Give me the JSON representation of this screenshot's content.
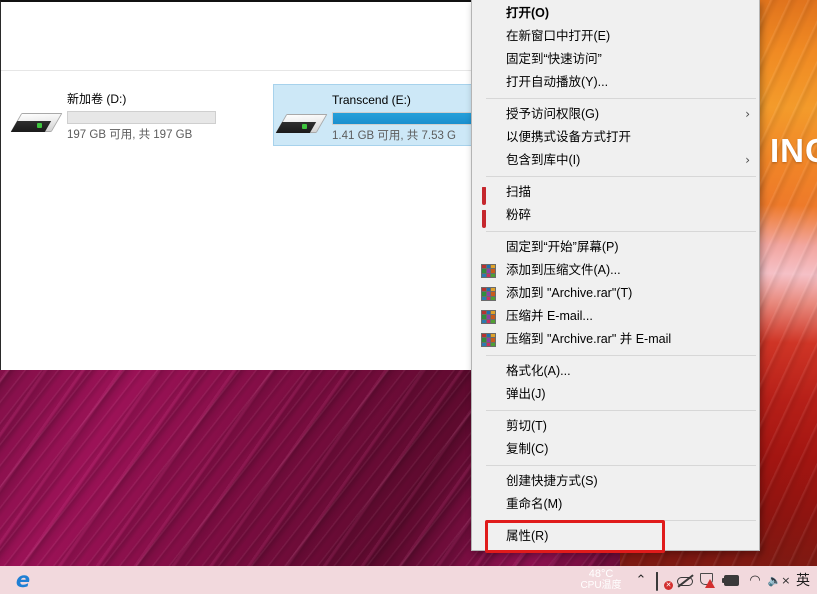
{
  "explorer": {
    "drives": [
      {
        "name": "新加卷 (D:)",
        "capacity_text": "197 GB 可用, 共 197 GB",
        "used_percent": 0,
        "selected": false,
        "icon": "removable-drive-icon"
      },
      {
        "name": "Transcend (E:)",
        "capacity_text": "1.41 GB 可用, 共 7.53 G",
        "used_percent": 100,
        "selected": true,
        "icon": "removable-drive-icon"
      }
    ]
  },
  "context_menu": {
    "groups": [
      {
        "items": [
          {
            "label": "打开(O)",
            "bold": true,
            "icon": null,
            "submenu": false
          },
          {
            "label": "在新窗口中打开(E)",
            "bold": false,
            "icon": null,
            "submenu": false
          },
          {
            "label": "固定到“快速访问”",
            "bold": false,
            "icon": null,
            "submenu": false
          },
          {
            "label": "打开自动播放(Y)...",
            "bold": false,
            "icon": null,
            "submenu": false
          }
        ]
      },
      {
        "items": [
          {
            "label": "授予访问权限(G)",
            "bold": false,
            "icon": null,
            "submenu": true
          },
          {
            "label": "以便携式设备方式打开",
            "bold": false,
            "icon": null,
            "submenu": false
          },
          {
            "label": "包含到库中(I)",
            "bold": false,
            "icon": null,
            "submenu": true
          }
        ]
      },
      {
        "items": [
          {
            "label": "扫描",
            "bold": false,
            "icon": "shield-icon",
            "submenu": false
          },
          {
            "label": "粉碎",
            "bold": false,
            "icon": "shield-icon",
            "submenu": false
          }
        ]
      },
      {
        "items": [
          {
            "label": "固定到“开始”屏幕(P)",
            "bold": false,
            "icon": null,
            "submenu": false
          },
          {
            "label": "添加到压缩文件(A)...",
            "bold": false,
            "icon": "winrar-icon",
            "submenu": false
          },
          {
            "label": "添加到 \"Archive.rar\"(T)",
            "bold": false,
            "icon": "winrar-icon",
            "submenu": false
          },
          {
            "label": "压缩并 E-mail...",
            "bold": false,
            "icon": "winrar-icon",
            "submenu": false
          },
          {
            "label": "压缩到 \"Archive.rar\" 并 E-mail",
            "bold": false,
            "icon": "winrar-icon",
            "submenu": false
          }
        ]
      },
      {
        "items": [
          {
            "label": "格式化(A)...",
            "bold": false,
            "icon": null,
            "submenu": false
          },
          {
            "label": "弹出(J)",
            "bold": false,
            "icon": null,
            "submenu": false
          }
        ]
      },
      {
        "items": [
          {
            "label": "剪切(T)",
            "bold": false,
            "icon": null,
            "submenu": false
          },
          {
            "label": "复制(C)",
            "bold": false,
            "icon": null,
            "submenu": false
          }
        ]
      },
      {
        "items": [
          {
            "label": "创建快捷方式(S)",
            "bold": false,
            "icon": null,
            "submenu": false
          },
          {
            "label": "重命名(M)",
            "bold": false,
            "icon": null,
            "submenu": false
          }
        ]
      },
      {
        "items": [
          {
            "label": "属性(R)",
            "bold": false,
            "icon": null,
            "submenu": false,
            "highlighted": true
          }
        ]
      }
    ],
    "submenu_arrow": "›"
  },
  "annotation": {
    "color": "#e01b1b",
    "target_label": "属性(R)"
  },
  "wallpaper": {
    "text": "INCR"
  },
  "taskbar": {
    "edge_glyph": "e",
    "cpu_temp": "48°C",
    "cpu_label": "CPU温度",
    "tray": {
      "chevron": "⌃",
      "ime": "英",
      "volume_muted_glyph": "⏷×",
      "wifi_glyph": "◠"
    }
  }
}
